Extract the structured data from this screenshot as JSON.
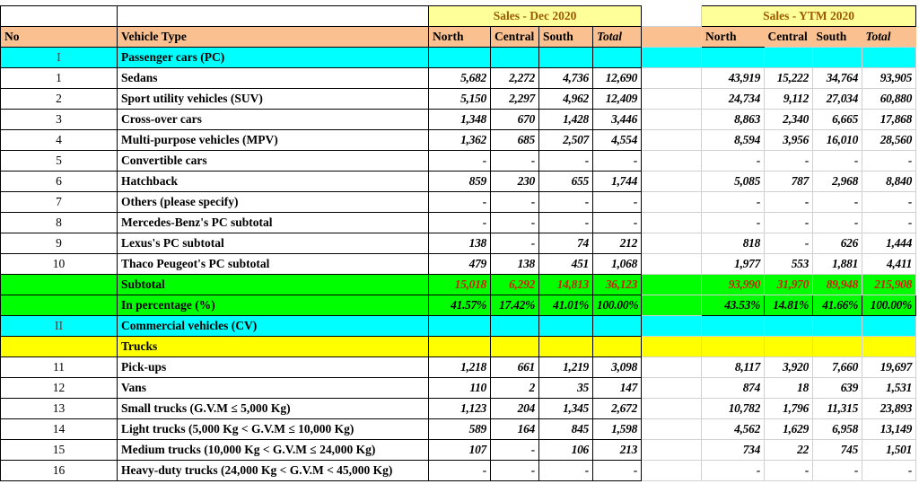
{
  "header": {
    "sales_dec": "Sales - Dec 2020",
    "sales_ytm": "Sales - YTM 2020",
    "no": "No",
    "vehicle_type": "Vehicle Type",
    "cols": [
      "North",
      "Central",
      "South",
      "Total"
    ]
  },
  "sections": {
    "pc": {
      "no": "I",
      "label": "Passenger cars (PC)"
    },
    "cv": {
      "no": "II",
      "label": "Commercial vehicles (CV)"
    },
    "trucks": {
      "label": "Trucks"
    }
  },
  "pc_rows": [
    {
      "no": "1",
      "type": "Sedans",
      "dec": [
        "5,682",
        "2,272",
        "4,736",
        "12,690"
      ],
      "ytm": [
        "43,919",
        "15,222",
        "34,764",
        "93,905"
      ]
    },
    {
      "no": "2",
      "type": "Sport utility vehicles (SUV)",
      "dec": [
        "5,150",
        "2,297",
        "4,962",
        "12,409"
      ],
      "ytm": [
        "24,734",
        "9,112",
        "27,034",
        "60,880"
      ]
    },
    {
      "no": "3",
      "type": "Cross-over cars",
      "dec": [
        "1,348",
        "670",
        "1,428",
        "3,446"
      ],
      "ytm": [
        "8,863",
        "2,340",
        "6,665",
        "17,868"
      ]
    },
    {
      "no": "4",
      "type": "Multi-purpose vehicles (MPV)",
      "dec": [
        "1,362",
        "685",
        "2,507",
        "4,554"
      ],
      "ytm": [
        "8,594",
        "3,956",
        "16,010",
        "28,560"
      ]
    },
    {
      "no": "5",
      "type": "Convertible cars",
      "dec": [
        "-",
        "-",
        "-",
        "-"
      ],
      "ytm": [
        "-",
        "-",
        "-",
        "-"
      ]
    },
    {
      "no": "6",
      "type": "Hatchback",
      "dec": [
        "859",
        "230",
        "655",
        "1,744"
      ],
      "ytm": [
        "5,085",
        "787",
        "2,968",
        "8,840"
      ]
    },
    {
      "no": "7",
      "type": "Others (please specify)",
      "dec": [
        "-",
        "-",
        "-",
        "-"
      ],
      "ytm": [
        "-",
        "-",
        "-",
        "-"
      ]
    },
    {
      "no": "8",
      "type": "Mercedes-Benz's PC subtotal",
      "dec": [
        "-",
        "-",
        "-",
        "-"
      ],
      "ytm": [
        "-",
        "-",
        "-",
        "-"
      ]
    },
    {
      "no": "9",
      "type": "Lexus's PC subtotal",
      "dec": [
        "138",
        "-",
        "74",
        "212"
      ],
      "ytm": [
        "818",
        "-",
        "626",
        "1,444"
      ]
    },
    {
      "no": "10",
      "type": "Thaco Peugeot's PC subtotal",
      "dec": [
        "479",
        "138",
        "451",
        "1,068"
      ],
      "ytm": [
        "1,977",
        "553",
        "1,881",
        "4,411"
      ]
    }
  ],
  "subtotal": {
    "label": "Subtotal",
    "dec": [
      "15,018",
      "6,292",
      "14,813",
      "36,123"
    ],
    "ytm": [
      "93,990",
      "31,970",
      "89,948",
      "215,908"
    ]
  },
  "percentage": {
    "label": "In percentage (%)",
    "dec": [
      "41.57%",
      "17.42%",
      "41.01%",
      "100.00%"
    ],
    "ytm": [
      "43.53%",
      "14.81%",
      "41.66%",
      "100.00%"
    ]
  },
  "truck_rows": [
    {
      "no": "11",
      "type": "Pick-ups",
      "dec": [
        "1,218",
        "661",
        "1,219",
        "3,098"
      ],
      "ytm": [
        "8,117",
        "3,920",
        "7,660",
        "19,697"
      ]
    },
    {
      "no": "12",
      "type": "Vans",
      "dec": [
        "110",
        "2",
        "35",
        "147"
      ],
      "ytm": [
        "874",
        "18",
        "639",
        "1,531"
      ]
    },
    {
      "no": "13",
      "type": "Small trucks (G.V.M ≤ 5,000 Kg)",
      "dec": [
        "1,123",
        "204",
        "1,345",
        "2,672"
      ],
      "ytm": [
        "10,782",
        "1,796",
        "11,315",
        "23,893"
      ]
    },
    {
      "no": "14",
      "type": "Light trucks (5,000 Kg < G.V.M ≤ 10,000 Kg)",
      "dec": [
        "589",
        "164",
        "845",
        "1,598"
      ],
      "ytm": [
        "4,562",
        "1,629",
        "6,958",
        "13,149"
      ]
    },
    {
      "no": "15",
      "type": "Medium trucks  (10,000 Kg < G.V.M ≤ 24,000 Kg)",
      "dec": [
        "107",
        "-",
        "106",
        "213"
      ],
      "ytm": [
        "734",
        "22",
        "745",
        "1,501"
      ]
    },
    {
      "no": "16",
      "type": "Heavy-duty trucks          (24,000 Kg < G.V.M < 45,000 Kg)",
      "dec": [
        "-",
        "-",
        "-",
        "-"
      ],
      "ytm": [
        "-",
        "-",
        "-",
        "-"
      ]
    }
  ]
}
